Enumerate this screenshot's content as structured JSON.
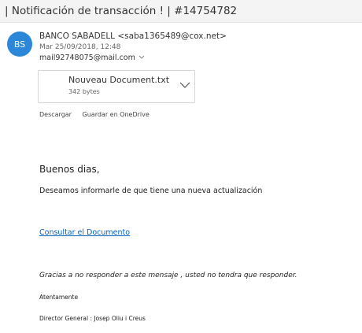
{
  "email": {
    "subject": "| Notificación de transacción ! | #14754782",
    "avatar_initials": "BS",
    "sender": "BANCO SABADELL <saba1365489@cox.net>",
    "date": "Mar 25/09/2018, 12:48",
    "to": "mail92748075@mail.com",
    "attachment": {
      "name": "Nouveau Document.txt",
      "size": "342 bytes"
    },
    "actions": {
      "download": "Descargar",
      "save_onedrive": "Guardar en OneDrive"
    },
    "body": {
      "greeting": "Buenos dias,",
      "info": "Deseamos informarle de que tiene una nueva actualización",
      "link": "Consultar el Documento",
      "thanks": "Gracias a no responder a este mensaje , usted no tendra que responder.",
      "regards": "Atentamente",
      "signature": "Director General : Josep Oliu i Creus"
    }
  },
  "colors": {
    "avatar": "#2b88d8",
    "link": "#0563c1",
    "subject_bar": "#f4f4f4"
  },
  "icons": {
    "recipient_expand": "chevron-down-icon",
    "attachment_menu": "chevron-down-icon"
  }
}
